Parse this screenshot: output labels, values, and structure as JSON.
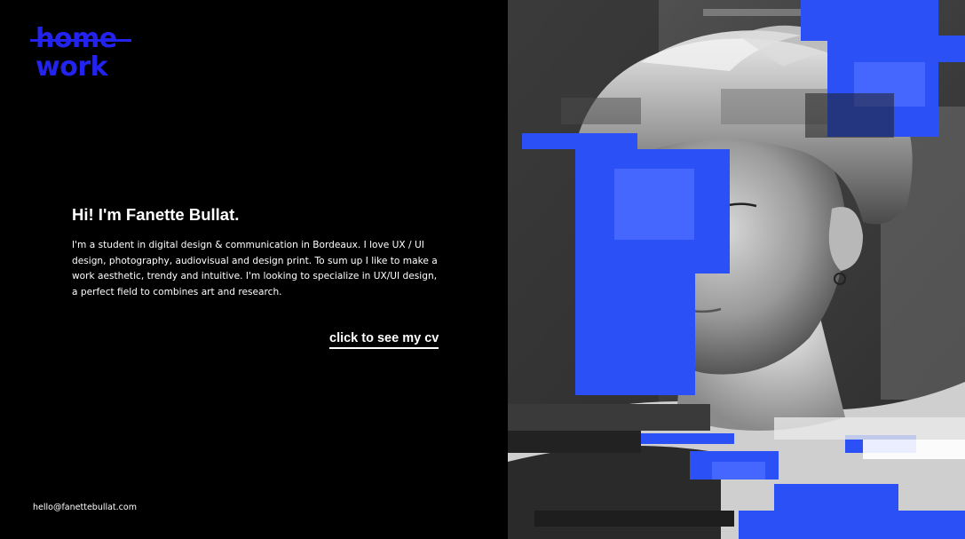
{
  "logo": {
    "line1": "home",
    "line2": "work"
  },
  "intro": {
    "title": "Hi! I'm Fanette Bullat.",
    "body": "I'm a student in digital design & communication in Bordeaux. I love UX / UI design, photography, audiovisual and design print. To sum up I like to make a work aesthetic, trendy and intuitive. I'm looking to specialize in UX/UI design, a perfect field to combines art and research."
  },
  "cta": {
    "label": "click to see my cv"
  },
  "footer": {
    "email": "hello@fanettebullat.com"
  },
  "colors": {
    "accent": "#2323f0",
    "background": "#000000",
    "text": "#ffffff"
  }
}
